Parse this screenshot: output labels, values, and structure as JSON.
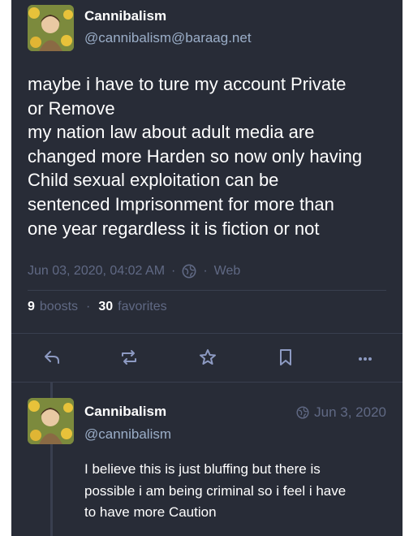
{
  "status": {
    "display_name": "Cannibalism",
    "account": "@cannibalism@baraag.net",
    "content_lines": [
      "maybe i have to ture my account Private",
      "or Remove",
      "my nation law about adult media are",
      "changed more Harden so now only having",
      "Child sexual exploitation can be",
      "sentenced Imprisonment for more than",
      "one year regardless it is fiction or not"
    ],
    "date": "Jun 03, 2020, 04:02 AM",
    "visibility_icon": "globe-icon",
    "application": "Web",
    "boosts_count": "9",
    "boosts_label": "boosts",
    "favorites_count": "30",
    "favorites_label": "favorites"
  },
  "actions": {
    "reply_icon": "reply-icon",
    "boost_icon": "boost-icon",
    "favourite_icon": "star-icon",
    "bookmark_icon": "bookmark-icon",
    "more_icon": "more-icon"
  },
  "reply": {
    "display_name": "Cannibalism",
    "account": "@cannibalism",
    "date": "Jun 3, 2020",
    "content_lines": [
      "I believe this is just bluffing but there is",
      "possible i am being criminal so i feel i have",
      "to have more Caution"
    ]
  },
  "colors": {
    "background": "#282c37",
    "primary_text": "#ffffff",
    "secondary_text": "#9baec8",
    "muted_text": "#606984",
    "separator": "#393f4f"
  }
}
